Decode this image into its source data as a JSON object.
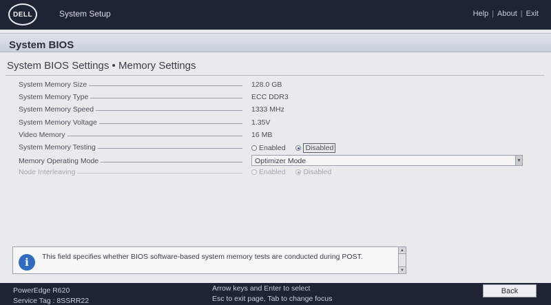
{
  "header": {
    "logo_text": "DELL",
    "title": "System Setup",
    "links": [
      "Help",
      "About",
      "Exit"
    ],
    "separator": "|"
  },
  "section": {
    "title": "System BIOS",
    "subtitle": "System BIOS Settings • Memory Settings"
  },
  "rows": [
    {
      "label": "System Memory Size",
      "value": "128.0 GB"
    },
    {
      "label": "System Memory Type",
      "value": "ECC DDR3"
    },
    {
      "label": "System Memory Speed",
      "value": "1333 MHz"
    },
    {
      "label": "System Memory Voltage",
      "value": "1.35V"
    },
    {
      "label": "Video Memory",
      "value": "16 MB"
    }
  ],
  "memory_testing": {
    "label": "System Memory Testing",
    "option_enabled": "Enabled",
    "option_disabled": "Disabled",
    "selected": "Disabled"
  },
  "operating_mode": {
    "label": "Memory Operating Mode",
    "value": "Optimizer Mode"
  },
  "node_interleaving": {
    "label": "Node Interleaving",
    "option_enabled": "Enabled",
    "option_disabled": "Disabled",
    "selected": "Disabled"
  },
  "help": {
    "icon": "info-icon",
    "icon_glyph": "i",
    "text": "This field specifies whether BIOS software-based system memory tests are conducted during POST."
  },
  "footer": {
    "model": "PowerEdge R620",
    "service_tag": "Service Tag : 8SSRR22",
    "hint_line1": "Arrow keys and Enter to select",
    "hint_line2": "Esc to exit page, Tab to change focus",
    "back_label": "Back"
  }
}
